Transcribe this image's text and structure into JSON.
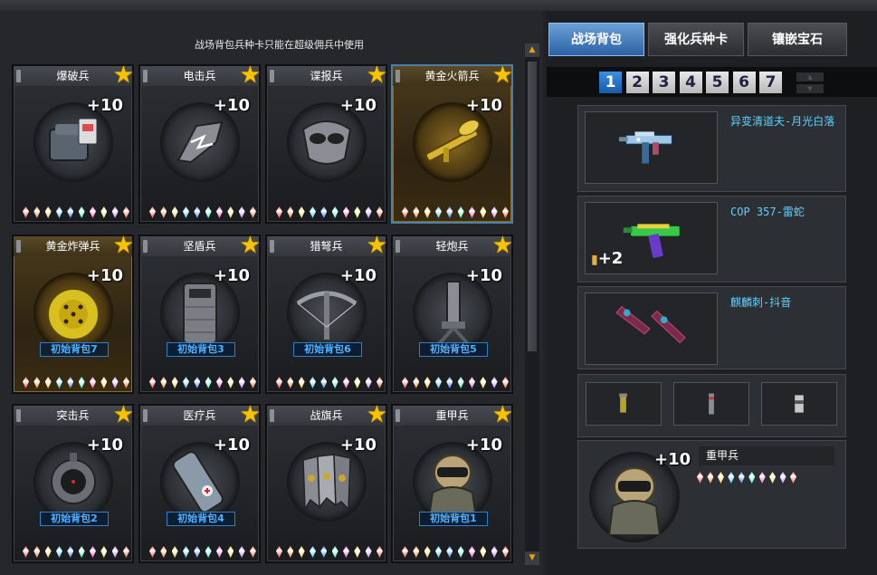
{
  "notice": "战场背包兵种卡只能在超级佣兵中使用",
  "gem_colors": [
    "#ff4a4a",
    "#ff8a3a",
    "#ffd23a",
    "#3ad0ff",
    "#3a8aff",
    "#3affc8",
    "#ff5ad0",
    "#ffe05a",
    "#c08aff",
    "#ff6a3a"
  ],
  "cards": [
    {
      "name": "爆破兵",
      "bonus": "+10",
      "icon": "demolition-pack-icon",
      "gold": false,
      "pack": ""
    },
    {
      "name": "电击兵",
      "bonus": "+10",
      "icon": "electric-claw-icon",
      "gold": false,
      "pack": ""
    },
    {
      "name": "谍报兵",
      "bonus": "+10",
      "icon": "spy-mask-icon",
      "gold": false,
      "pack": ""
    },
    {
      "name": "黄金火箭兵",
      "bonus": "+10",
      "icon": "golden-rocket-launcher-icon",
      "gold": true,
      "pack": ""
    },
    {
      "name": "黄金炸弹兵",
      "bonus": "+10",
      "icon": "golden-bomb-icon",
      "gold": true,
      "pack": "初始背包7"
    },
    {
      "name": "坚盾兵",
      "bonus": "+10",
      "icon": "shield-icon",
      "gold": false,
      "pack": "初始背包3"
    },
    {
      "name": "猎弩兵",
      "bonus": "+10",
      "icon": "crossbow-icon",
      "gold": false,
      "pack": "初始背包6"
    },
    {
      "name": "轻炮兵",
      "bonus": "+10",
      "icon": "mortar-icon",
      "gold": false,
      "pack": "初始背包5"
    },
    {
      "name": "突击兵",
      "bonus": "+10",
      "icon": "assault-scope-icon",
      "gold": false,
      "pack": "初始背包2"
    },
    {
      "name": "医疗兵",
      "bonus": "+10",
      "icon": "medic-canister-icon",
      "gold": false,
      "pack": "初始背包4"
    },
    {
      "name": "战旗兵",
      "bonus": "+10",
      "icon": "war-banner-icon",
      "gold": false,
      "pack": ""
    },
    {
      "name": "重甲兵",
      "bonus": "+10",
      "icon": "heavy-armor-icon",
      "gold": false,
      "pack": "初始背包1"
    }
  ],
  "tabs": [
    {
      "label": "战场背包",
      "active": true
    },
    {
      "label": "强化兵种卡",
      "active": false
    },
    {
      "label": "镶嵌宝石",
      "active": false
    }
  ],
  "pages": [
    "1",
    "2",
    "3",
    "4",
    "5",
    "6",
    "7"
  ],
  "active_page": "1",
  "loadout": [
    {
      "label": "异变清道夫-月光白落",
      "icon": "smg-moonlight-icon",
      "extra": ""
    },
    {
      "label": "COP 357-雷蛇",
      "icon": "pistol-razer-icon",
      "extra": "+2"
    },
    {
      "label": "麒麟刺-抖音",
      "icon": "twin-daggers-icon",
      "extra": ""
    }
  ],
  "throwables": [
    "grenade-icon",
    "flashbang-icon",
    "smoke-grenade-icon"
  ],
  "selected": {
    "name": "重甲兵",
    "bonus": "+10",
    "icon": "heavy-armor-icon"
  }
}
